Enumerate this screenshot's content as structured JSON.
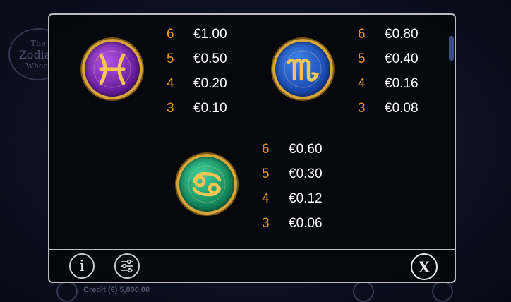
{
  "background": {
    "logo_line1": "The",
    "logo_line2": "Zodiac",
    "logo_line3": "Wheel",
    "credit_text": "Credit (€) 5,000.00"
  },
  "paytable": {
    "symbols": [
      {
        "name": "pisces",
        "icon": "pisces-icon",
        "color": "#7b2bb3",
        "pays": [
          {
            "count": "6",
            "value": "€1.00"
          },
          {
            "count": "5",
            "value": "€0.50"
          },
          {
            "count": "4",
            "value": "€0.20"
          },
          {
            "count": "3",
            "value": "€0.10"
          }
        ]
      },
      {
        "name": "scorpio",
        "icon": "scorpio-icon",
        "color": "#2458c4",
        "pays": [
          {
            "count": "6",
            "value": "€0.80"
          },
          {
            "count": "5",
            "value": "€0.40"
          },
          {
            "count": "4",
            "value": "€0.16"
          },
          {
            "count": "3",
            "value": "€0.08"
          }
        ]
      },
      {
        "name": "cancer",
        "icon": "cancer-icon",
        "color": "#17976a",
        "pays": [
          {
            "count": "6",
            "value": "€0.60"
          },
          {
            "count": "5",
            "value": "€0.30"
          },
          {
            "count": "4",
            "value": "€0.12"
          },
          {
            "count": "3",
            "value": "€0.06"
          }
        ]
      }
    ]
  },
  "footer": {
    "info_label": "i",
    "settings_icon": "sliders-icon",
    "close_label": "X"
  },
  "colors": {
    "count_color": "#e79a2c",
    "value_color": "#ffffff",
    "panel_border": "#b9bcc3",
    "gold_rim": "#d8a53b"
  }
}
